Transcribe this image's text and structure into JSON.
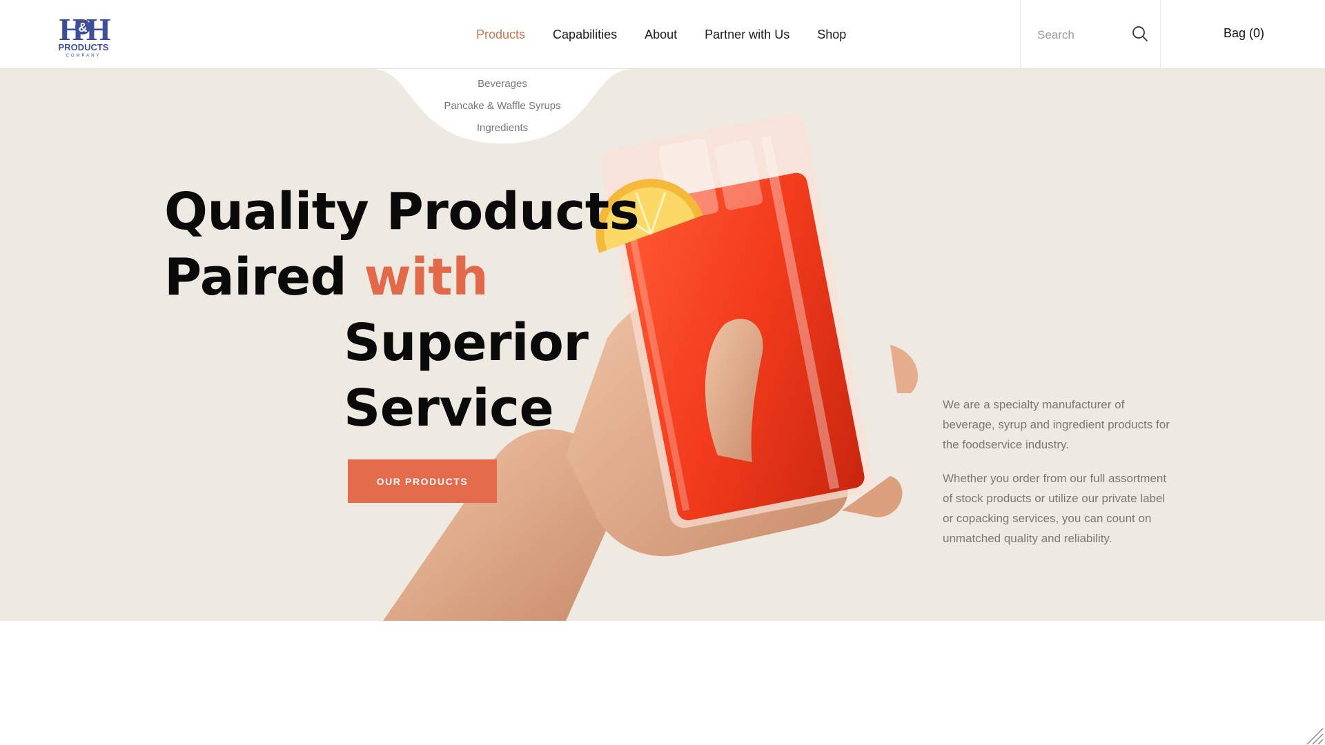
{
  "brand": {
    "logo_text": "H&H",
    "logo_subtitle": "PRODUCTS",
    "logo_tagline": "COMPANY",
    "logo_color": "#3d4f9a"
  },
  "nav": {
    "items": [
      {
        "label": "Products",
        "active": true
      },
      {
        "label": "Capabilities"
      },
      {
        "label": "About"
      },
      {
        "label": "Partner with Us"
      },
      {
        "label": "Shop"
      }
    ],
    "active_color": "#c9754f"
  },
  "products_dropdown": {
    "items": [
      "Beverages",
      "Pancake & Waffle Syrups",
      "Ingredients"
    ]
  },
  "search": {
    "placeholder": "Search",
    "icon": "search-icon"
  },
  "bag": {
    "label": "Bag (0)"
  },
  "hero": {
    "headline": {
      "line1": "Quality Products",
      "line2_prefix": "Paired ",
      "line2_accent": "with",
      "line3": "Superior",
      "line4": "Service"
    },
    "cta_label": "OUR PRODUCTS",
    "about_paragraphs": [
      "We are a specialty manufacturer of beverage, syrup and ingredient products for the foodservice industry.",
      "Whether you order from our full assortment of stock products or utilize our private label or copacking services, you can count on unmatched quality and reliability."
    ],
    "background_color": "#eeeae1",
    "accent_color": "#e46b4c"
  }
}
